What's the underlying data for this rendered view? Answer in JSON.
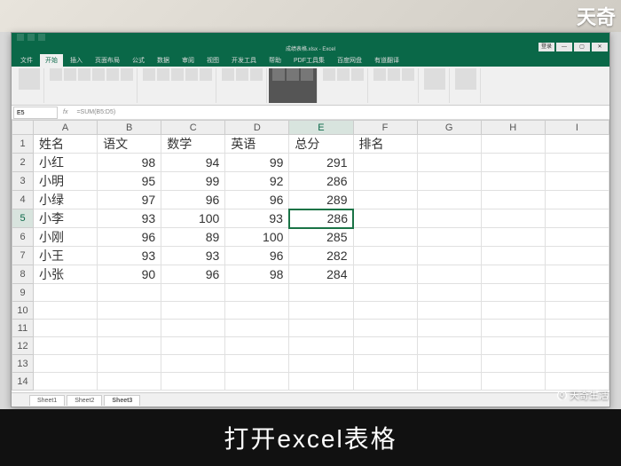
{
  "app": {
    "title": "成绩表格.xlsx - Excel",
    "signin": "登录"
  },
  "ribbon": {
    "tabs": [
      "文件",
      "开始",
      "插入",
      "页面布局",
      "公式",
      "数据",
      "审阅",
      "视图",
      "开发工具",
      "帮助",
      "PDF工具集",
      "百度网盘",
      "有道翻译"
    ],
    "active_tab": "开始"
  },
  "namebox": "E5",
  "formula": "=SUM(B5:D5)",
  "columns": [
    "A",
    "B",
    "C",
    "D",
    "E",
    "F",
    "G",
    "H",
    "I"
  ],
  "selected_cell": {
    "row": 5,
    "col": "E"
  },
  "headers": {
    "A": "姓名",
    "B": "语文",
    "C": "数学",
    "D": "英语",
    "E": "总分",
    "F": "排名"
  },
  "rows": [
    {
      "n": 2,
      "A": "小红",
      "B": 98,
      "C": 94,
      "D": 99,
      "E": 291
    },
    {
      "n": 3,
      "A": "小明",
      "B": 95,
      "C": 99,
      "D": 92,
      "E": 286
    },
    {
      "n": 4,
      "A": "小绿",
      "B": 97,
      "C": 96,
      "D": 96,
      "E": 289
    },
    {
      "n": 5,
      "A": "小李",
      "B": 93,
      "C": 100,
      "D": 93,
      "E": 286
    },
    {
      "n": 6,
      "A": "小刚",
      "B": 96,
      "C": 89,
      "D": 100,
      "E": 285
    },
    {
      "n": 7,
      "A": "小王",
      "B": 93,
      "C": 93,
      "D": 96,
      "E": 282
    },
    {
      "n": 8,
      "A": "小张",
      "B": 90,
      "C": 96,
      "D": 98,
      "E": 284
    }
  ],
  "empty_rows": [
    9,
    10,
    11,
    12,
    13,
    14
  ],
  "sheets": [
    "Sheet1",
    "Sheet2",
    "Sheet3"
  ],
  "active_sheet": "Sheet3",
  "watermark_top": "天奇",
  "watermark_bottom": "天奇生活",
  "caption": "打开excel表格"
}
